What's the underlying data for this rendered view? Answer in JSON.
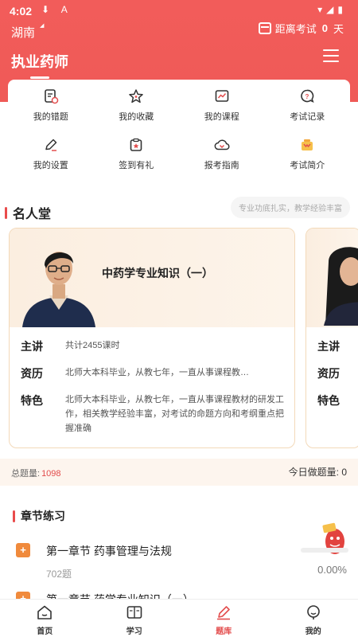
{
  "status_bar": {
    "time": "4:02",
    "left_icons": "⬇ A",
    "right_icons": "▾◢▮"
  },
  "header": {
    "region": "湖南",
    "countdown_prefix": "距离考试",
    "countdown_value": "0",
    "countdown_unit": "天",
    "app_title": "执业药师",
    "accent_color": "#ef5a57"
  },
  "quick_menu": [
    {
      "label": "我的错题",
      "icon": "wrong-questions-icon"
    },
    {
      "label": "我的收藏",
      "icon": "star-icon"
    },
    {
      "label": "我的课程",
      "icon": "course-icon"
    },
    {
      "label": "考试记录",
      "icon": "exam-record-icon"
    },
    {
      "label": "我的设置",
      "icon": "edit-icon"
    },
    {
      "label": "签到有礼",
      "icon": "checkin-gift-icon"
    },
    {
      "label": "报考指南",
      "icon": "guide-download-icon"
    },
    {
      "label": "考试简介",
      "icon": "crown-box-icon"
    }
  ],
  "famous": {
    "title": "名人堂",
    "tag": "专业功底扎实，教学经验丰富",
    "card": {
      "course": "中药学专业知识（一）",
      "lecturer_key": "主讲",
      "lecturer_val": "共计2455课时",
      "resume_key": "资历",
      "resume_val": "北师大本科毕业，从教七年，一直从事课程教…",
      "feature_key": "特色",
      "feature_val": "北师大本科毕业，从教七年，一直从事课程教材的研发工作，相关教学经验丰富，对考试的命题方向和考纲重点把握准确"
    },
    "card2": {
      "lecturer_key": "主讲",
      "resume_key": "资历",
      "feature_key": "特色"
    }
  },
  "totals": {
    "total_label": "总题量:",
    "total_value": "1098",
    "today_label": "今日做题量:",
    "today_value": "0"
  },
  "chapter": {
    "title": "章节练习",
    "items": [
      {
        "badge": "+",
        "name": "第一章节 药事管理与法规",
        "count": "702题",
        "percent": "0.00%",
        "progress": 0
      },
      {
        "badge": "+",
        "name": "第一章节 药学专业知识（一）"
      }
    ]
  },
  "nav": [
    {
      "label": "首页",
      "icon": "home-icon"
    },
    {
      "label": "学习",
      "icon": "book-icon"
    },
    {
      "label": "题库",
      "icon": "pen-icon",
      "active": true
    },
    {
      "label": "我的",
      "icon": "profile-icon"
    }
  ]
}
